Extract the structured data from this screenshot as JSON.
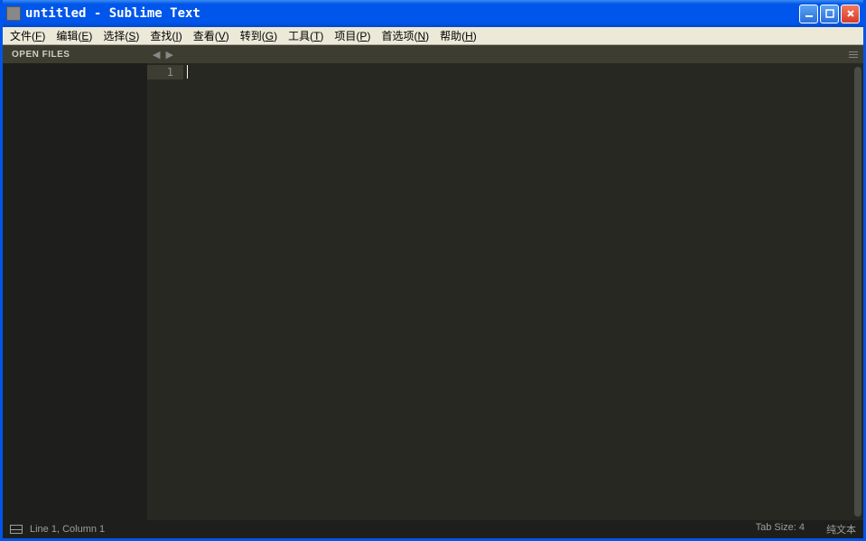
{
  "titlebar": {
    "title": "untitled - Sublime Text"
  },
  "menubar": {
    "items": [
      {
        "label": "文件",
        "mnemonic": "F"
      },
      {
        "label": "编辑",
        "mnemonic": "E"
      },
      {
        "label": "选择",
        "mnemonic": "S"
      },
      {
        "label": "查找",
        "mnemonic": "I"
      },
      {
        "label": "查看",
        "mnemonic": "V"
      },
      {
        "label": "转到",
        "mnemonic": "G"
      },
      {
        "label": "工具",
        "mnemonic": "T"
      },
      {
        "label": "项目",
        "mnemonic": "P"
      },
      {
        "label": "首选项",
        "mnemonic": "N"
      },
      {
        "label": "帮助",
        "mnemonic": "H"
      }
    ]
  },
  "sidebar": {
    "header": "OPEN FILES"
  },
  "editor": {
    "line_number": "1"
  },
  "statusbar": {
    "position": "Line 1, Column 1",
    "tab_size": "Tab Size: 4",
    "syntax": "纯文本"
  }
}
